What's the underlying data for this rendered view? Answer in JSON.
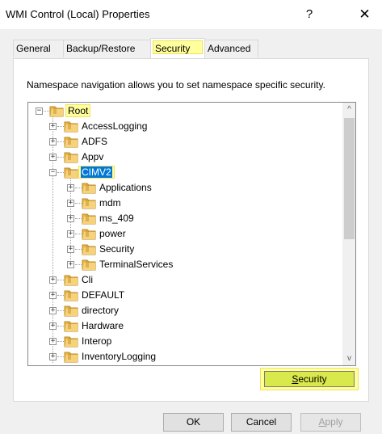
{
  "window": {
    "title": "WMI Control (Local) Properties",
    "help": "?",
    "close": "✕"
  },
  "tabs": [
    {
      "label": "General"
    },
    {
      "label": "Backup/Restore"
    },
    {
      "label": "Security"
    },
    {
      "label": "Advanced"
    }
  ],
  "panel": {
    "description": "Namespace navigation allows you to set namespace specific security."
  },
  "tree": {
    "root": "Root",
    "nodes": [
      {
        "label": "AccessLogging",
        "expander": "+"
      },
      {
        "label": "ADFS",
        "expander": "+"
      },
      {
        "label": "Appv",
        "expander": "+"
      },
      {
        "label": "CIMV2",
        "expander": "−"
      },
      {
        "label": "Applications",
        "expander": "+"
      },
      {
        "label": "mdm",
        "expander": "+"
      },
      {
        "label": "ms_409",
        "expander": "+"
      },
      {
        "label": "power",
        "expander": "+"
      },
      {
        "label": "Security",
        "expander": "+"
      },
      {
        "label": "TerminalServices",
        "expander": "+"
      },
      {
        "label": "Cli",
        "expander": "+"
      },
      {
        "label": "DEFAULT",
        "expander": "+"
      },
      {
        "label": "directory",
        "expander": "+"
      },
      {
        "label": "Hardware",
        "expander": "+"
      },
      {
        "label": "Interop",
        "expander": "+"
      },
      {
        "label": "InventoryLogging",
        "expander": "+"
      }
    ],
    "root_expander": "−",
    "scroll_up": "^",
    "scroll_down": "v"
  },
  "buttons": {
    "security": "Security",
    "ok": "OK",
    "cancel": "Cancel",
    "apply": "Apply"
  },
  "colors": {
    "highlight": "#ffff9d",
    "selection": "#0078d7"
  }
}
